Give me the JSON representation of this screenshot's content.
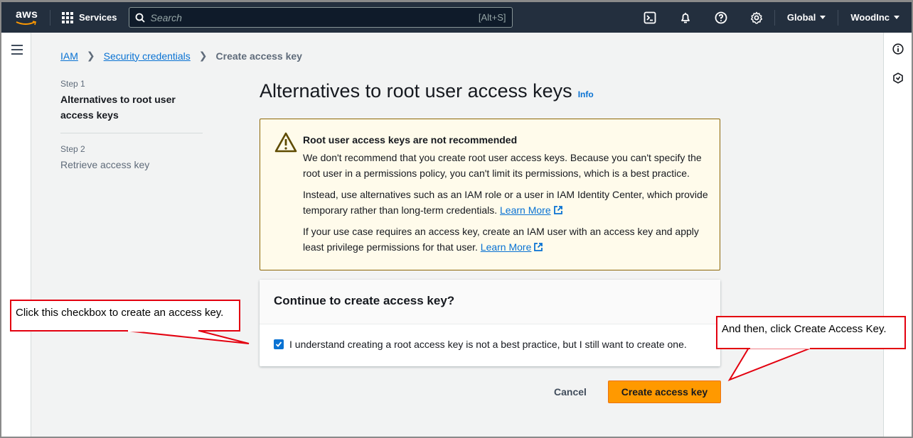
{
  "nav": {
    "logo_text": "aws",
    "services_label": "Services",
    "search_placeholder": "Search",
    "search_shortcut": "[Alt+S]",
    "region_label": "Global",
    "account_label": "WoodInc",
    "icons": [
      "cloudshell-icon",
      "bell-icon",
      "help-icon",
      "settings-icon"
    ]
  },
  "breadcrumb": {
    "items": [
      "IAM",
      "Security credentials"
    ],
    "current": "Create access key"
  },
  "steps": [
    {
      "number": "Step 1",
      "title": "Alternatives to root user access keys",
      "active": true
    },
    {
      "number": "Step 2",
      "title": "Retrieve access key",
      "active": false
    }
  ],
  "page": {
    "title": "Alternatives to root user access keys",
    "info_link": "Info"
  },
  "warning": {
    "title": "Root user access keys are not recommended",
    "paragraph1": "We don't recommend that you create root user access keys. Because you can't specify the root user in a permissions policy, you can't limit its permissions, which is a best practice.",
    "paragraph2": "Instead, use alternatives such as an IAM role or a user in IAM Identity Center, which provide temporary rather than long-term credentials.",
    "paragraph3": "If your use case requires an access key, create an IAM user with an access key and apply least privilege permissions for that user.",
    "learn_more": "Learn More"
  },
  "confirm": {
    "heading": "Continue to create access key?",
    "checkbox_label": "I understand creating a root access key is not a best practice, but I still want to create one.",
    "checked": true
  },
  "actions": {
    "cancel": "Cancel",
    "create": "Create access key"
  },
  "callouts": {
    "checkbox_note": "Click this checkbox to create an access key.",
    "button_note": "And then, click Create Access Key."
  },
  "colors": {
    "nav_bg": "#232f3e",
    "link": "#0972d3",
    "primary_button": "#ff9900",
    "warning_bg": "#fffbeb",
    "callout_border": "#e3000f"
  }
}
